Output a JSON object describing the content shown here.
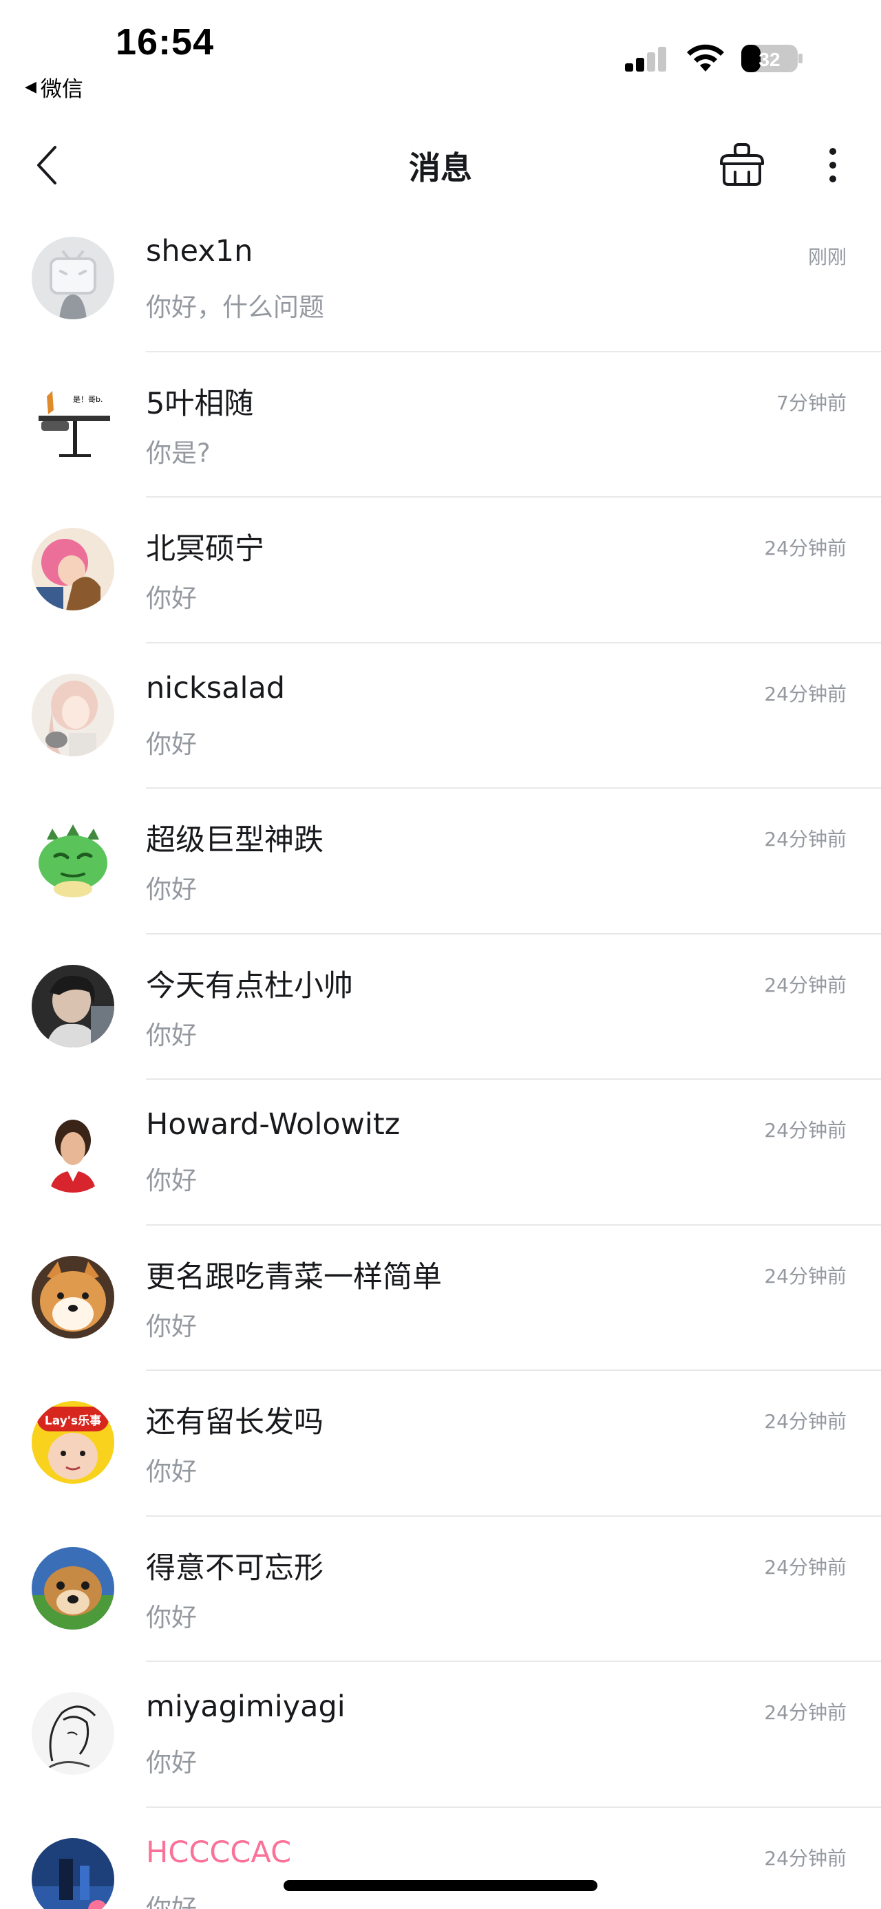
{
  "status_bar": {
    "time": "16:54",
    "back_app": "微信",
    "battery": "32"
  },
  "nav": {
    "title": "消息"
  },
  "conversations": [
    {
      "name": "shex1n",
      "message": "你好，什么问题",
      "time": "刚刚",
      "avatar": "default-tv-avatar"
    },
    {
      "name": "5叶相随",
      "message": "你是?",
      "time": "7分钟前",
      "avatar": "chair-meme-avatar",
      "avatar_text": "是！哥b."
    },
    {
      "name": "北冥硕宁",
      "message": "你好",
      "time": "24分钟前",
      "avatar": "anime-pink-hair-avatar"
    },
    {
      "name": "nicksalad",
      "message": "你好",
      "time": "24分钟前",
      "avatar": "anime-girl-avatar"
    },
    {
      "name": "超级巨型神跌",
      "message": "你好",
      "time": "24分钟前",
      "avatar": "green-dragon-avatar"
    },
    {
      "name": "今天有点杜小帅",
      "message": "你好",
      "time": "24分钟前",
      "avatar": "photo-person-avatar"
    },
    {
      "name": "Howard-Wolowitz",
      "message": "你好",
      "time": "24分钟前",
      "avatar": "howard-avatar"
    },
    {
      "name": "更名跟吃青菜一样简单",
      "message": "你好",
      "time": "24分钟前",
      "avatar": "shiba-dog-avatar"
    },
    {
      "name": "还有留长发吗",
      "message": "你好",
      "time": "24分钟前",
      "avatar": "lays-baby-avatar",
      "avatar_text": "Lay's乐事"
    },
    {
      "name": "得意不可忘形",
      "message": "你好",
      "time": "24分钟前",
      "avatar": "dog-grass-avatar"
    },
    {
      "name": "miyagimiyagi",
      "message": "你好",
      "time": "24分钟前",
      "avatar": "sketch-avatar"
    },
    {
      "name": "HCCCCAC",
      "message": "你好",
      "time": "24分钟前",
      "avatar": "blue-scene-avatar",
      "vip": true
    }
  ]
}
